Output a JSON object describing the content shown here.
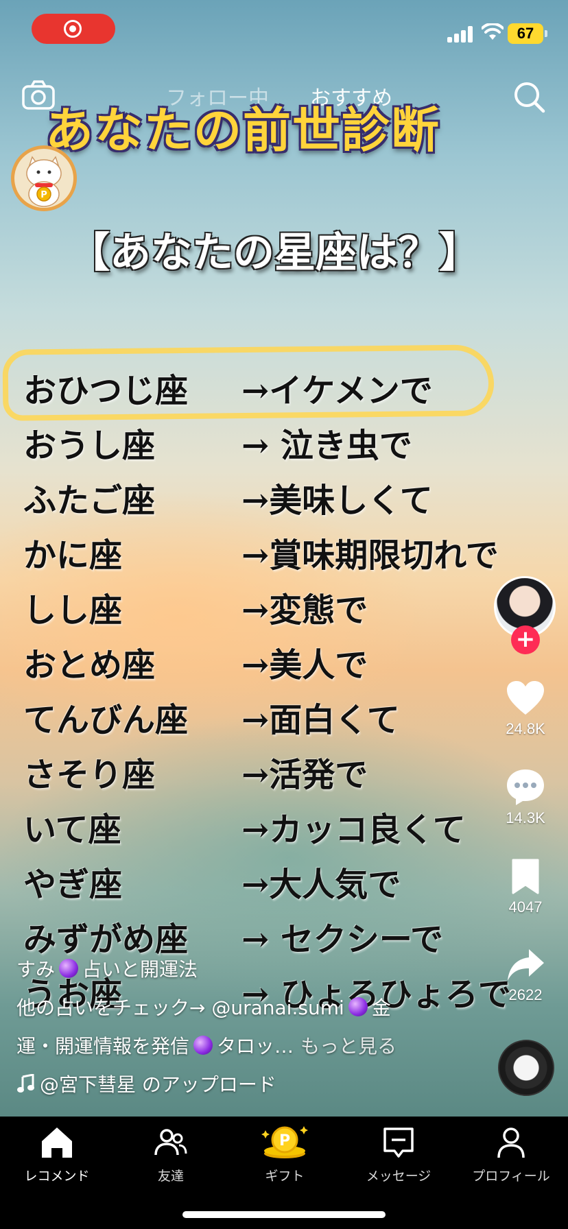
{
  "status_bar": {
    "battery": "67"
  },
  "top_nav": {
    "tabs": [
      {
        "label": "フォロー中"
      },
      {
        "label": "おすすめ"
      }
    ]
  },
  "video": {
    "headline": "あなたの前世診断",
    "question": "【あなたの星座は？】",
    "zodiac": [
      {
        "sign": "おひつじ座",
        "result": "→イケメンで"
      },
      {
        "sign": "おうし座",
        "result": "→ 泣き虫で"
      },
      {
        "sign": "ふたご座",
        "result": "→美味しくて"
      },
      {
        "sign": "かに座",
        "result": "→賞味期限切れで"
      },
      {
        "sign": "しし座",
        "result": "→変態で"
      },
      {
        "sign": "おとめ座",
        "result": "→美人で"
      },
      {
        "sign": "てんびん座",
        "result": "→面白くて"
      },
      {
        "sign": "さそり座",
        "result": "→活発で"
      },
      {
        "sign": "いて座",
        "result": "→カッコ良くて"
      },
      {
        "sign": "やぎ座",
        "result": "→大人気で"
      },
      {
        "sign": "みずがめ座",
        "result": "→ セクシーで"
      },
      {
        "sign": "うお座",
        "result": "→ ひょろひょろで"
      }
    ]
  },
  "rail": {
    "likes": "24.8K",
    "comments": "14.3K",
    "saves": "4047",
    "shares": "2622"
  },
  "caption": {
    "author_prefix": "すみ",
    "author_suffix": "占いと開運法",
    "line2_a": "他の占いをチェック→ @uranai.sumi",
    "line2_b": "金",
    "line3_a": "運・開運情報を発信",
    "line3_b": "タロッ…",
    "more": "もっと見る",
    "music": "@宮下彗星 のアップロード"
  },
  "bottom_nav": [
    {
      "label": "レコメンド"
    },
    {
      "label": "友達"
    },
    {
      "label": "ギフト"
    },
    {
      "label": "メッセージ"
    },
    {
      "label": "プロフィール"
    }
  ],
  "colors": {
    "record_red": "#e8352f",
    "battery_yellow": "#ffd92f",
    "follow_pink": "#fe2c55",
    "headline_gold": "#ffd43b",
    "highlight_yellow": "#ffd650"
  },
  "icons": [
    "camera-icon",
    "search-icon",
    "heart-icon",
    "comment-icon",
    "bookmark-icon",
    "share-icon",
    "home-icon",
    "friends-icon",
    "gift-coin-icon",
    "message-icon",
    "profile-icon",
    "music-note-icon"
  ]
}
